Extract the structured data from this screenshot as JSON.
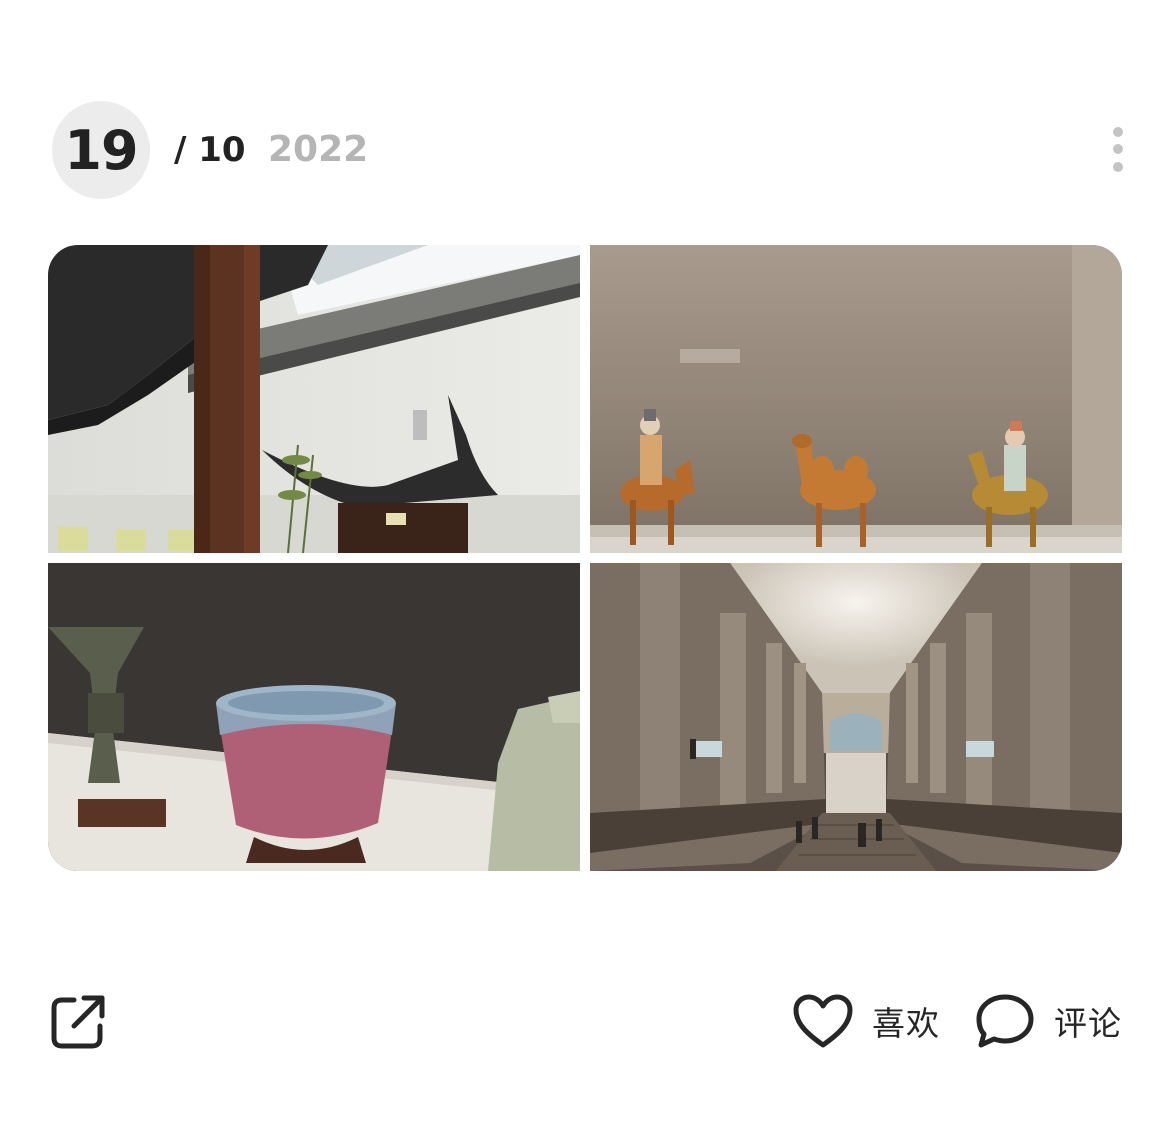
{
  "post": {
    "date": {
      "day": "19",
      "month": "/ 10",
      "year": "2022"
    },
    "photos": [
      {
        "id": "photo-1",
        "subject": "chinese-garden-pavilion"
      },
      {
        "id": "photo-2",
        "subject": "tang-figurines-display"
      },
      {
        "id": "photo-3",
        "subject": "ceramics-display"
      },
      {
        "id": "photo-4",
        "subject": "museum-grand-staircase"
      }
    ],
    "actions": {
      "share_icon": "share-icon",
      "like_label": "喜欢",
      "like_icon": "heart-icon",
      "comment_label": "评论",
      "comment_icon": "speech-bubble-icon",
      "more_icon": "vertical-ellipsis-icon"
    }
  }
}
